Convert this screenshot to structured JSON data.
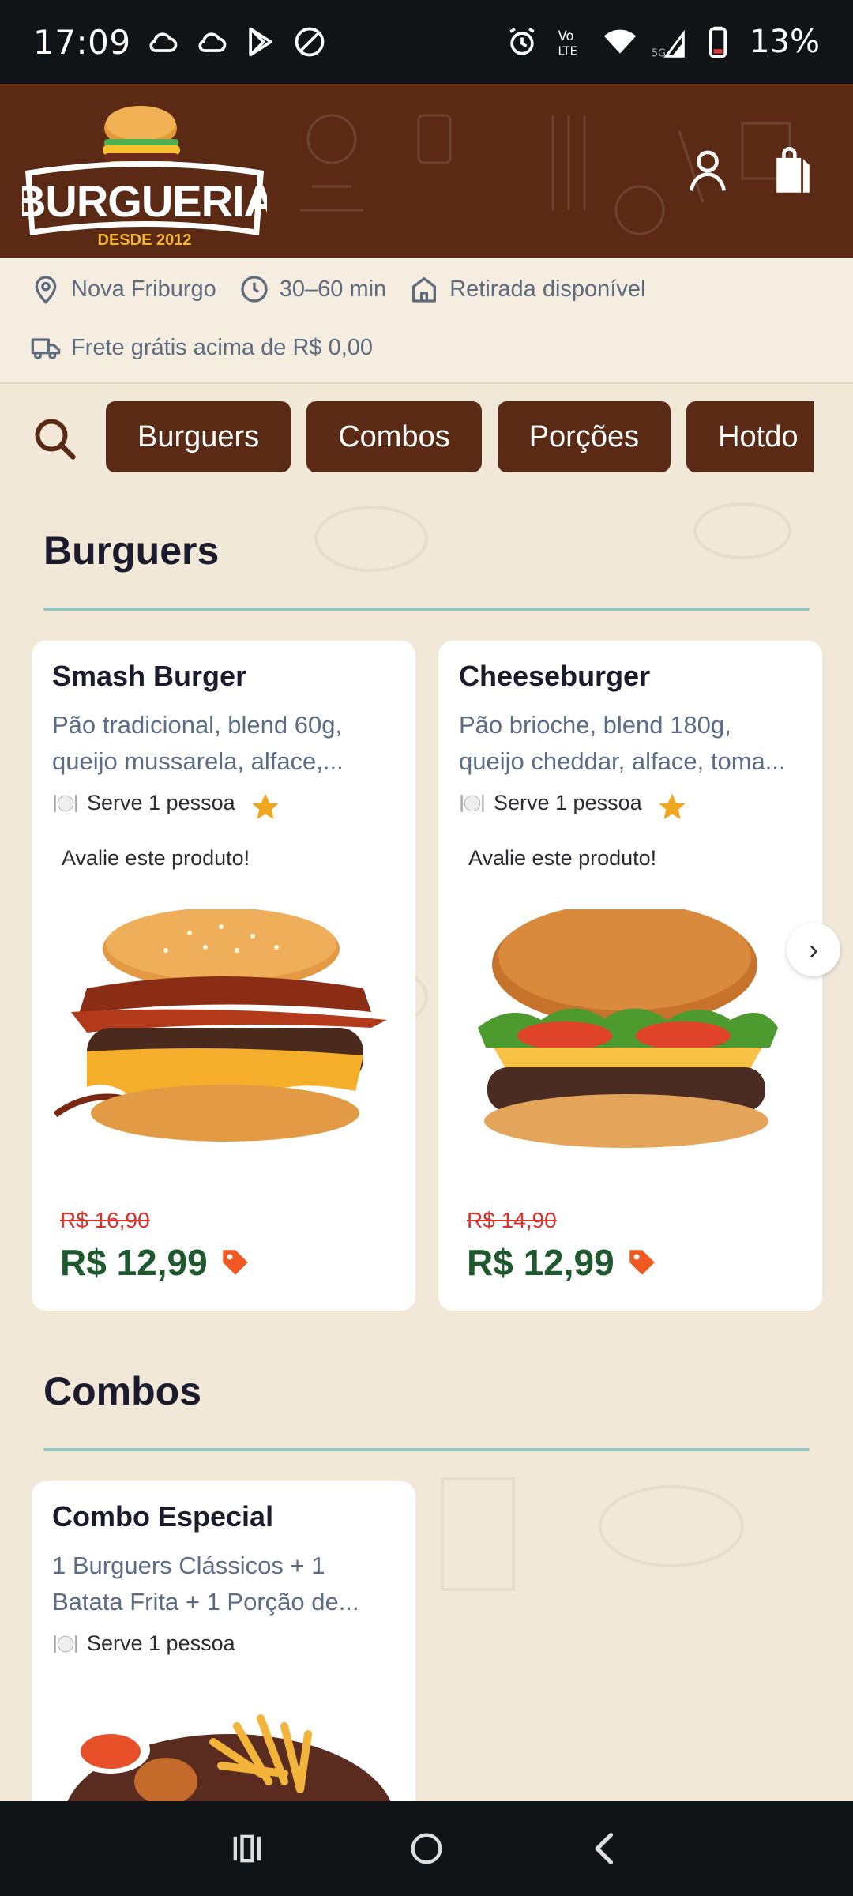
{
  "status_bar": {
    "time": "17:09",
    "battery": "13%"
  },
  "header": {
    "logo": {
      "title": "BURGUERIA",
      "subtitle": "DESDE 2012"
    },
    "icons": [
      "user-icon",
      "shopping-bag-icon"
    ]
  },
  "info": {
    "location": "Nova Friburgo",
    "delivery_time": "30–60 min",
    "pickup": "Retirada disponível",
    "shipping": "Frete grátis acima de R$ 0,00"
  },
  "categories": [
    "Burguers",
    "Combos",
    "Porções",
    "Hotdo"
  ],
  "sections": [
    {
      "title": "Burguers",
      "products": [
        {
          "name": "Smash Burger",
          "desc_line1": "Pão tradicional, blend 60g,",
          "desc_line2": "queijo mussarela, alface,...",
          "serves": "Serve 1 pessoa",
          "rate": "Avalie este produto!",
          "old_price": "R$ 16,90",
          "price": "R$ 12,99"
        },
        {
          "name": "Cheeseburger",
          "desc_line1": "Pão brioche, blend 180g,",
          "desc_line2": "queijo cheddar, alface, toma...",
          "serves": "Serve 1 pessoa",
          "rate": "Avalie este produto!",
          "old_price": "R$ 14,90",
          "price": "R$ 12,99"
        }
      ]
    },
    {
      "title": "Combos",
      "products": [
        {
          "name": "Combo Especial",
          "desc_line1": "1 Burguers Clássicos + 1",
          "desc_line2": "Batata Frita + 1 Porção de...",
          "serves": "Serve 1 pessoa"
        }
      ]
    }
  ],
  "colors": {
    "brand_brown": "#5a2a14",
    "background": "#f2e8d8",
    "price_green": "#1f5a2e",
    "old_price_red": "#d9322b",
    "divider_teal": "#92c4c3"
  }
}
